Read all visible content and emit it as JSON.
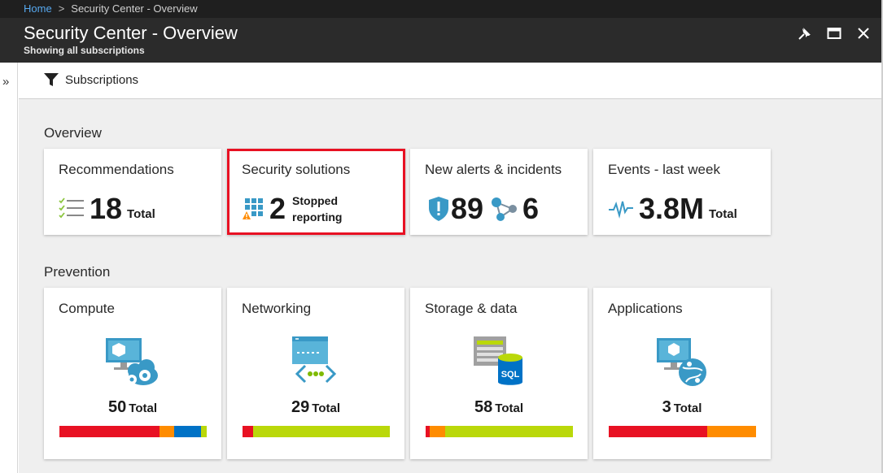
{
  "breadcrumb": {
    "home": "Home",
    "separator": ">",
    "current": "Security Center - Overview"
  },
  "blade": {
    "title": "Security Center - Overview",
    "subtitle": "Showing all subscriptions"
  },
  "window_controls": {
    "pin": "pin-icon",
    "maximize": "maximize-icon",
    "close": "close-icon"
  },
  "sidebar": {
    "expand_glyph": "»"
  },
  "toolbar": {
    "subscriptions_label": "Subscriptions"
  },
  "overview": {
    "heading": "Overview",
    "recommendations": {
      "title": "Recommendations",
      "value": "18",
      "unit": "Total"
    },
    "security_solutions": {
      "title": "Security solutions",
      "value": "2",
      "line1": "Stopped",
      "line2": "reporting"
    },
    "alerts": {
      "title": "New alerts & incidents",
      "alerts_value": "89",
      "incidents_value": "6"
    },
    "events": {
      "title": "Events - last week",
      "value": "3.8M",
      "unit": "Total"
    }
  },
  "prevention": {
    "heading": "Prevention",
    "tiles": [
      {
        "title": "Compute",
        "value": "50",
        "unit": "Total",
        "bar": [
          {
            "color": "#e81123",
            "fraction": 0.68
          },
          {
            "color": "#ff8c00",
            "fraction": 0.1
          },
          {
            "color": "#0072c6",
            "fraction": 0.18
          },
          {
            "color": "#bad80a",
            "fraction": 0.04
          }
        ]
      },
      {
        "title": "Networking",
        "value": "29",
        "unit": "Total",
        "bar": [
          {
            "color": "#e81123",
            "fraction": 0.07
          },
          {
            "color": "#bad80a",
            "fraction": 0.93
          }
        ]
      },
      {
        "title": "Storage & data",
        "value": "58",
        "unit": "Total",
        "bar": [
          {
            "color": "#e81123",
            "fraction": 0.03
          },
          {
            "color": "#ff8c00",
            "fraction": 0.1
          },
          {
            "color": "#bad80a",
            "fraction": 0.87
          }
        ]
      },
      {
        "title": "Applications",
        "value": "3",
        "unit": "Total",
        "bar": [
          {
            "color": "#e81123",
            "fraction": 0.67
          },
          {
            "color": "#ff8c00",
            "fraction": 0.33
          }
        ]
      }
    ]
  },
  "colors": {
    "highlight": "#e81123",
    "link": "#57a9f0",
    "header_bg": "#2b2b2b",
    "azure_blue": "#3999c6"
  }
}
